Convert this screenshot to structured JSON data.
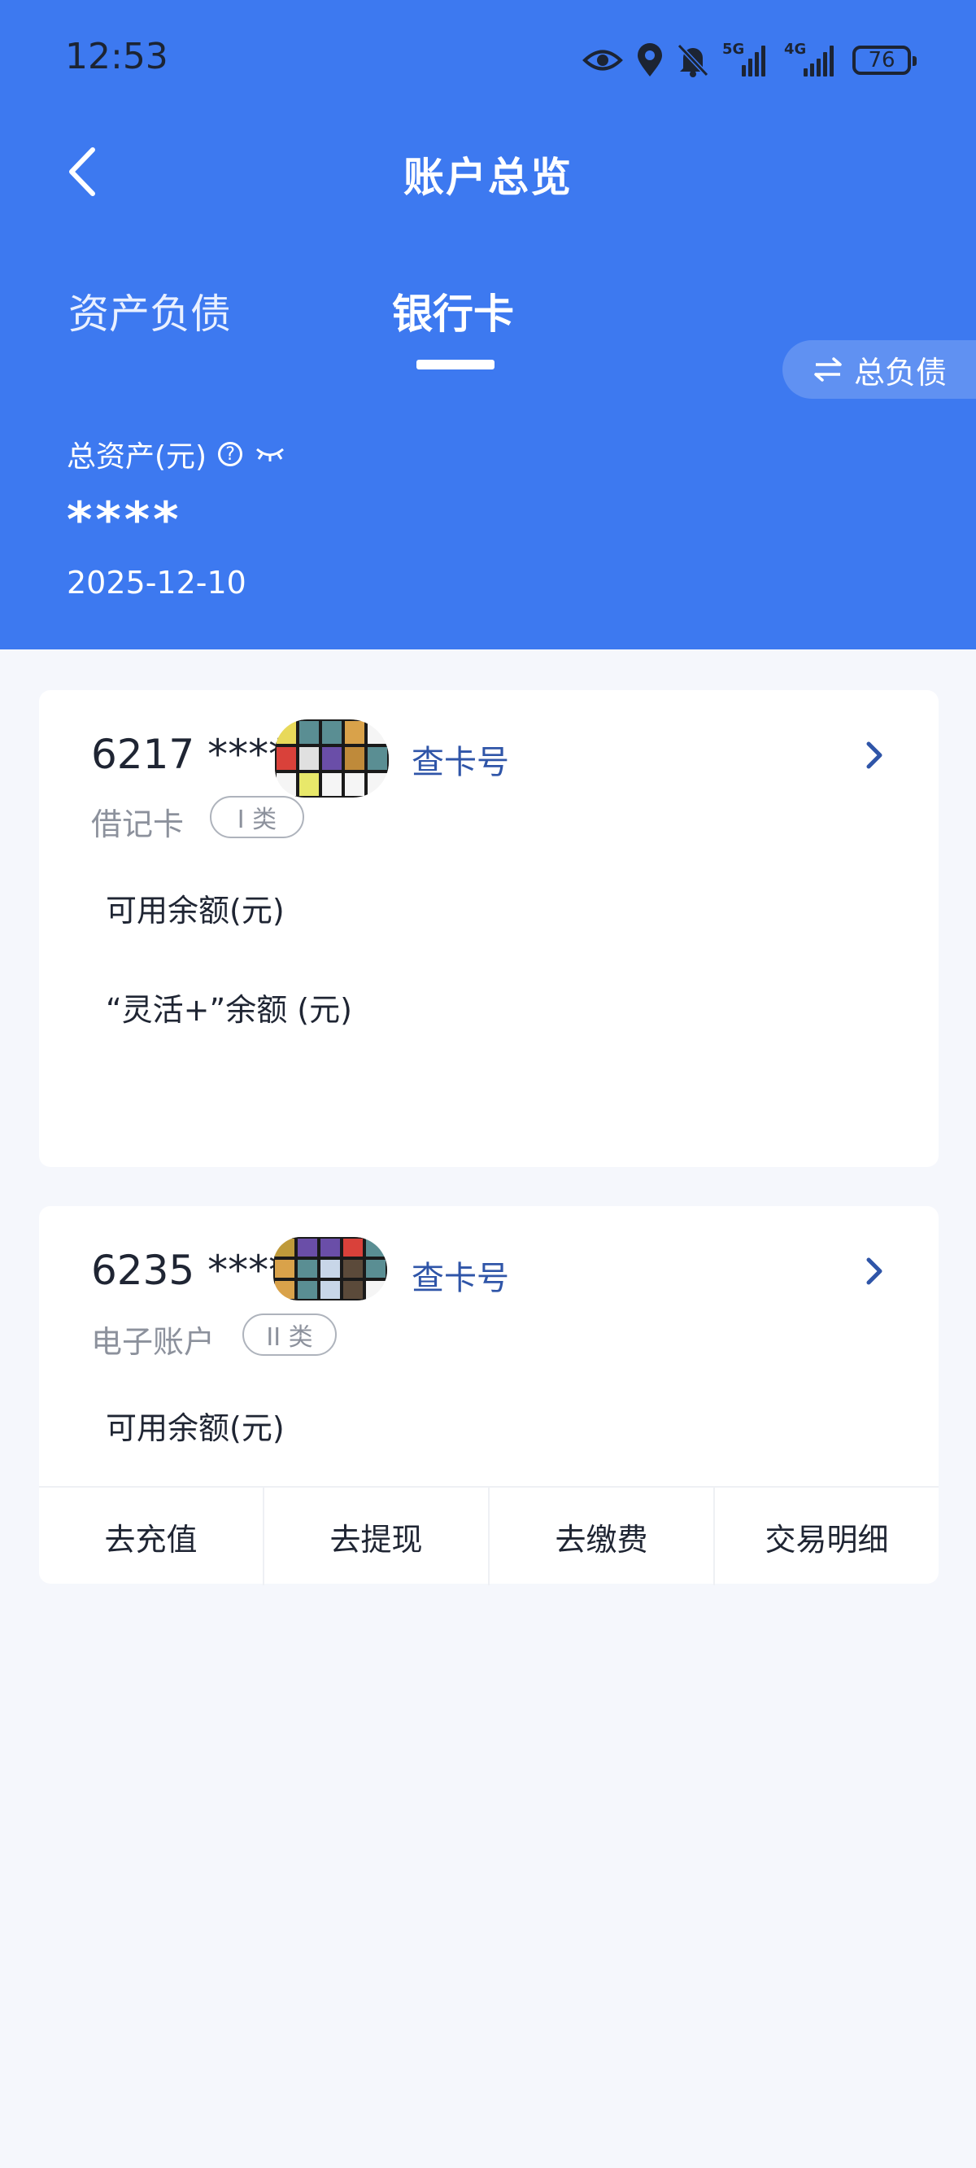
{
  "status_bar": {
    "time": "12:53",
    "icons": [
      "eye-icon",
      "location-pin-icon",
      "bell-muted-icon",
      "signal-5g-icon",
      "signal-4g-icon",
      "battery-icon"
    ],
    "signal_1_tag": "5G",
    "signal_2_tag": "4G",
    "battery_level": "76"
  },
  "header": {
    "title": "账户总览",
    "tabs": [
      {
        "label": "资产负债",
        "active": false
      },
      {
        "label": "银行卡",
        "active": true
      }
    ],
    "switch_button": "总负债",
    "total_assets_label": "总资产(元)",
    "total_assets_value": "****",
    "date": "2025-12-10"
  },
  "cards": [
    {
      "number": "6217 ****",
      "show_number_link": "查卡号",
      "type": "借记卡",
      "class_badge": "I 类",
      "balances": [
        "可用余额(元)",
        "“灵活+”余额 (元)"
      ]
    },
    {
      "number": "6235 ****",
      "show_number_link": "查卡号",
      "type": "电子账户",
      "class_badge": "II 类",
      "balances": [
        "可用余额(元)"
      ],
      "actions": [
        "去充值",
        "去提现",
        "去缴费",
        "交易明细"
      ]
    }
  ],
  "colors": {
    "header_bg": "#3d79f0",
    "link": "#2f55a8",
    "page_bg": "#f5f7fc"
  }
}
